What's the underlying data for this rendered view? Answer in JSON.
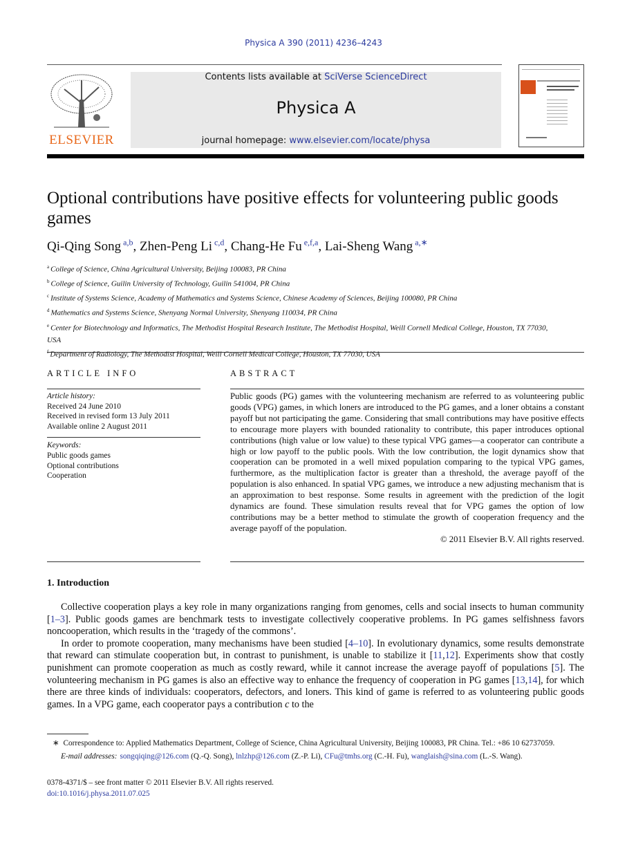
{
  "journal_citation": "Physica A 390 (2011) 4236–4243",
  "banner": {
    "contents_prefix": "Contents lists available at ",
    "contents_link": "SciVerse ScienceDirect",
    "journal": "Physica A",
    "homepage_prefix": "journal homepage: ",
    "homepage_link": "www.elsevier.com/locate/physa"
  },
  "publisher_logo": "ELSEVIER",
  "title": "Optional contributions have positive effects for volunteering public goods games",
  "authors": [
    {
      "name": "Qi-Qing Song",
      "sup": "a,b",
      "sep": ", "
    },
    {
      "name": "Zhen-Peng Li",
      "sup": "c,d",
      "sep": ", "
    },
    {
      "name": "Chang-He Fu",
      "sup": "e,f,a",
      "sep": ", "
    },
    {
      "name": "Lai-Sheng Wang",
      "sup": "a,∗",
      "sep": ""
    }
  ],
  "affiliations": [
    {
      "key": "a",
      "text": "College of Science, China Agricultural University, Beijing 100083, PR China"
    },
    {
      "key": "b",
      "text": "College of Science, Guilin University of Technology, Guilin 541004, PR China"
    },
    {
      "key": "c",
      "text": "Institute of Systems Science, Academy of Mathematics and Systems Science, Chinese Academy of Sciences, Beijing 100080, PR China"
    },
    {
      "key": "d",
      "text": "Mathematics and Systems Science, Shenyang Normal University, Shenyang 110034, PR China"
    },
    {
      "key": "e",
      "text": "Center for Biotechnology and Informatics, The Methodist Hospital Research Institute, The Methodist Hospital, Weill Cornell Medical College, Houston, TX 77030, USA"
    },
    {
      "key": "f",
      "text": "Department of Radiology, The Methodist Hospital, Weill Cornell Medical College, Houston, TX 77030, USA"
    }
  ],
  "article_info": {
    "heading": "ARTICLE INFO",
    "history_label": "Article history:",
    "history": [
      "Received 24 June 2010",
      "Received in revised form 13 July 2011",
      "Available online 2 August 2011"
    ],
    "keywords_label": "Keywords:",
    "keywords": [
      "Public goods games",
      "Optional contributions",
      "Cooperation"
    ]
  },
  "abstract": {
    "heading": "ABSTRACT",
    "text": "Public goods (PG) games with the volunteering mechanism are referred to as volunteering public goods (VPG) games, in which loners are introduced to the PG games, and a loner obtains a constant payoff but not participating the game. Considering that small contributions may have positive effects to encourage more players with bounded rationality to contribute, this paper introduces optional contributions (high value or low value) to these typical VPG games—a cooperator can contribute a high or low payoff to the public pools. With the low contribution, the logit dynamics show that cooperation can be promoted in a well mixed population comparing to the typical VPG games, furthermore, as the multiplication factor is greater than a threshold, the average payoff of the population is also enhanced. In spatial VPG games, we introduce a new adjusting mechanism that is an approximation to best response. Some results in agreement with the prediction of the logit dynamics are found. These simulation results reveal that for VPG games the option of low contributions may be a better method to stimulate the growth of cooperation frequency and the average payoff of the population.",
    "copyright": "© 2011 Elsevier B.V. All rights reserved."
  },
  "introduction": {
    "heading": "1.  Introduction",
    "paragraphs": [
      [
        {
          "t": "Collective cooperation plays a key role in many organizations ranging from genomes, cells and social insects to human community ["
        },
        {
          "t": "1–3",
          "link": true
        },
        {
          "t": "]. Public goods games are benchmark tests to investigate collectively cooperative problems. In PG games selfishness favors noncooperation, which results in the ‘tragedy of the commons’."
        }
      ],
      [
        {
          "t": "In order to promote cooperation, many mechanisms have been studied ["
        },
        {
          "t": "4–10",
          "link": true
        },
        {
          "t": "]. In evolutionary dynamics, some results demonstrate that reward can stimulate cooperation but, in contrast to punishment, is unable to stabilize it ["
        },
        {
          "t": "11",
          "link": true
        },
        {
          "t": ","
        },
        {
          "t": "12",
          "link": true
        },
        {
          "t": "]. Experiments show that costly punishment can promote cooperation as much as costly reward, while it cannot increase the average payoff of populations ["
        },
        {
          "t": "5",
          "link": true
        },
        {
          "t": "]. The volunteering mechanism in PG games is also an effective way to enhance the frequency of cooperation in PG games ["
        },
        {
          "t": "13",
          "link": true
        },
        {
          "t": ","
        },
        {
          "t": "14",
          "link": true
        },
        {
          "t": "], for which there are three kinds of individuals: cooperators, defectors, and loners. This kind of game is referred to as volunteering public goods games. In a VPG game, each cooperator pays a contribution "
        },
        {
          "t": "c",
          "italic": true
        },
        {
          "t": " to the"
        }
      ]
    ]
  },
  "footnotes": {
    "star": "∗",
    "correspondence": "Correspondence to: Applied Mathematics Department, College of Science, China Agricultural University, Beijing 100083, PR China. Tel.: +86 10 62737059.",
    "email_label": "E-mail addresses:",
    "emails": [
      {
        "addr": "songqiqing@126.com",
        "who": " (Q.-Q. Song), "
      },
      {
        "addr": "lnlzhp@126.com",
        "who": " (Z.-P. Li), "
      },
      {
        "addr": "CFu@tmhs.org",
        "who": " (C.-H. Fu), "
      },
      {
        "addr": "wanglaish@sina.com",
        "who": " (L.-S. Wang)."
      }
    ],
    "front_matter": "0378-4371/$ – see front matter © 2011 Elsevier B.V. All rights reserved.",
    "doi": "doi:10.1016/j.physa.2011.07.025"
  },
  "colors": {
    "link": "#2b3a9e",
    "elsevier_orange": "#e8681b",
    "banner_bg": "#e9e9e9"
  }
}
